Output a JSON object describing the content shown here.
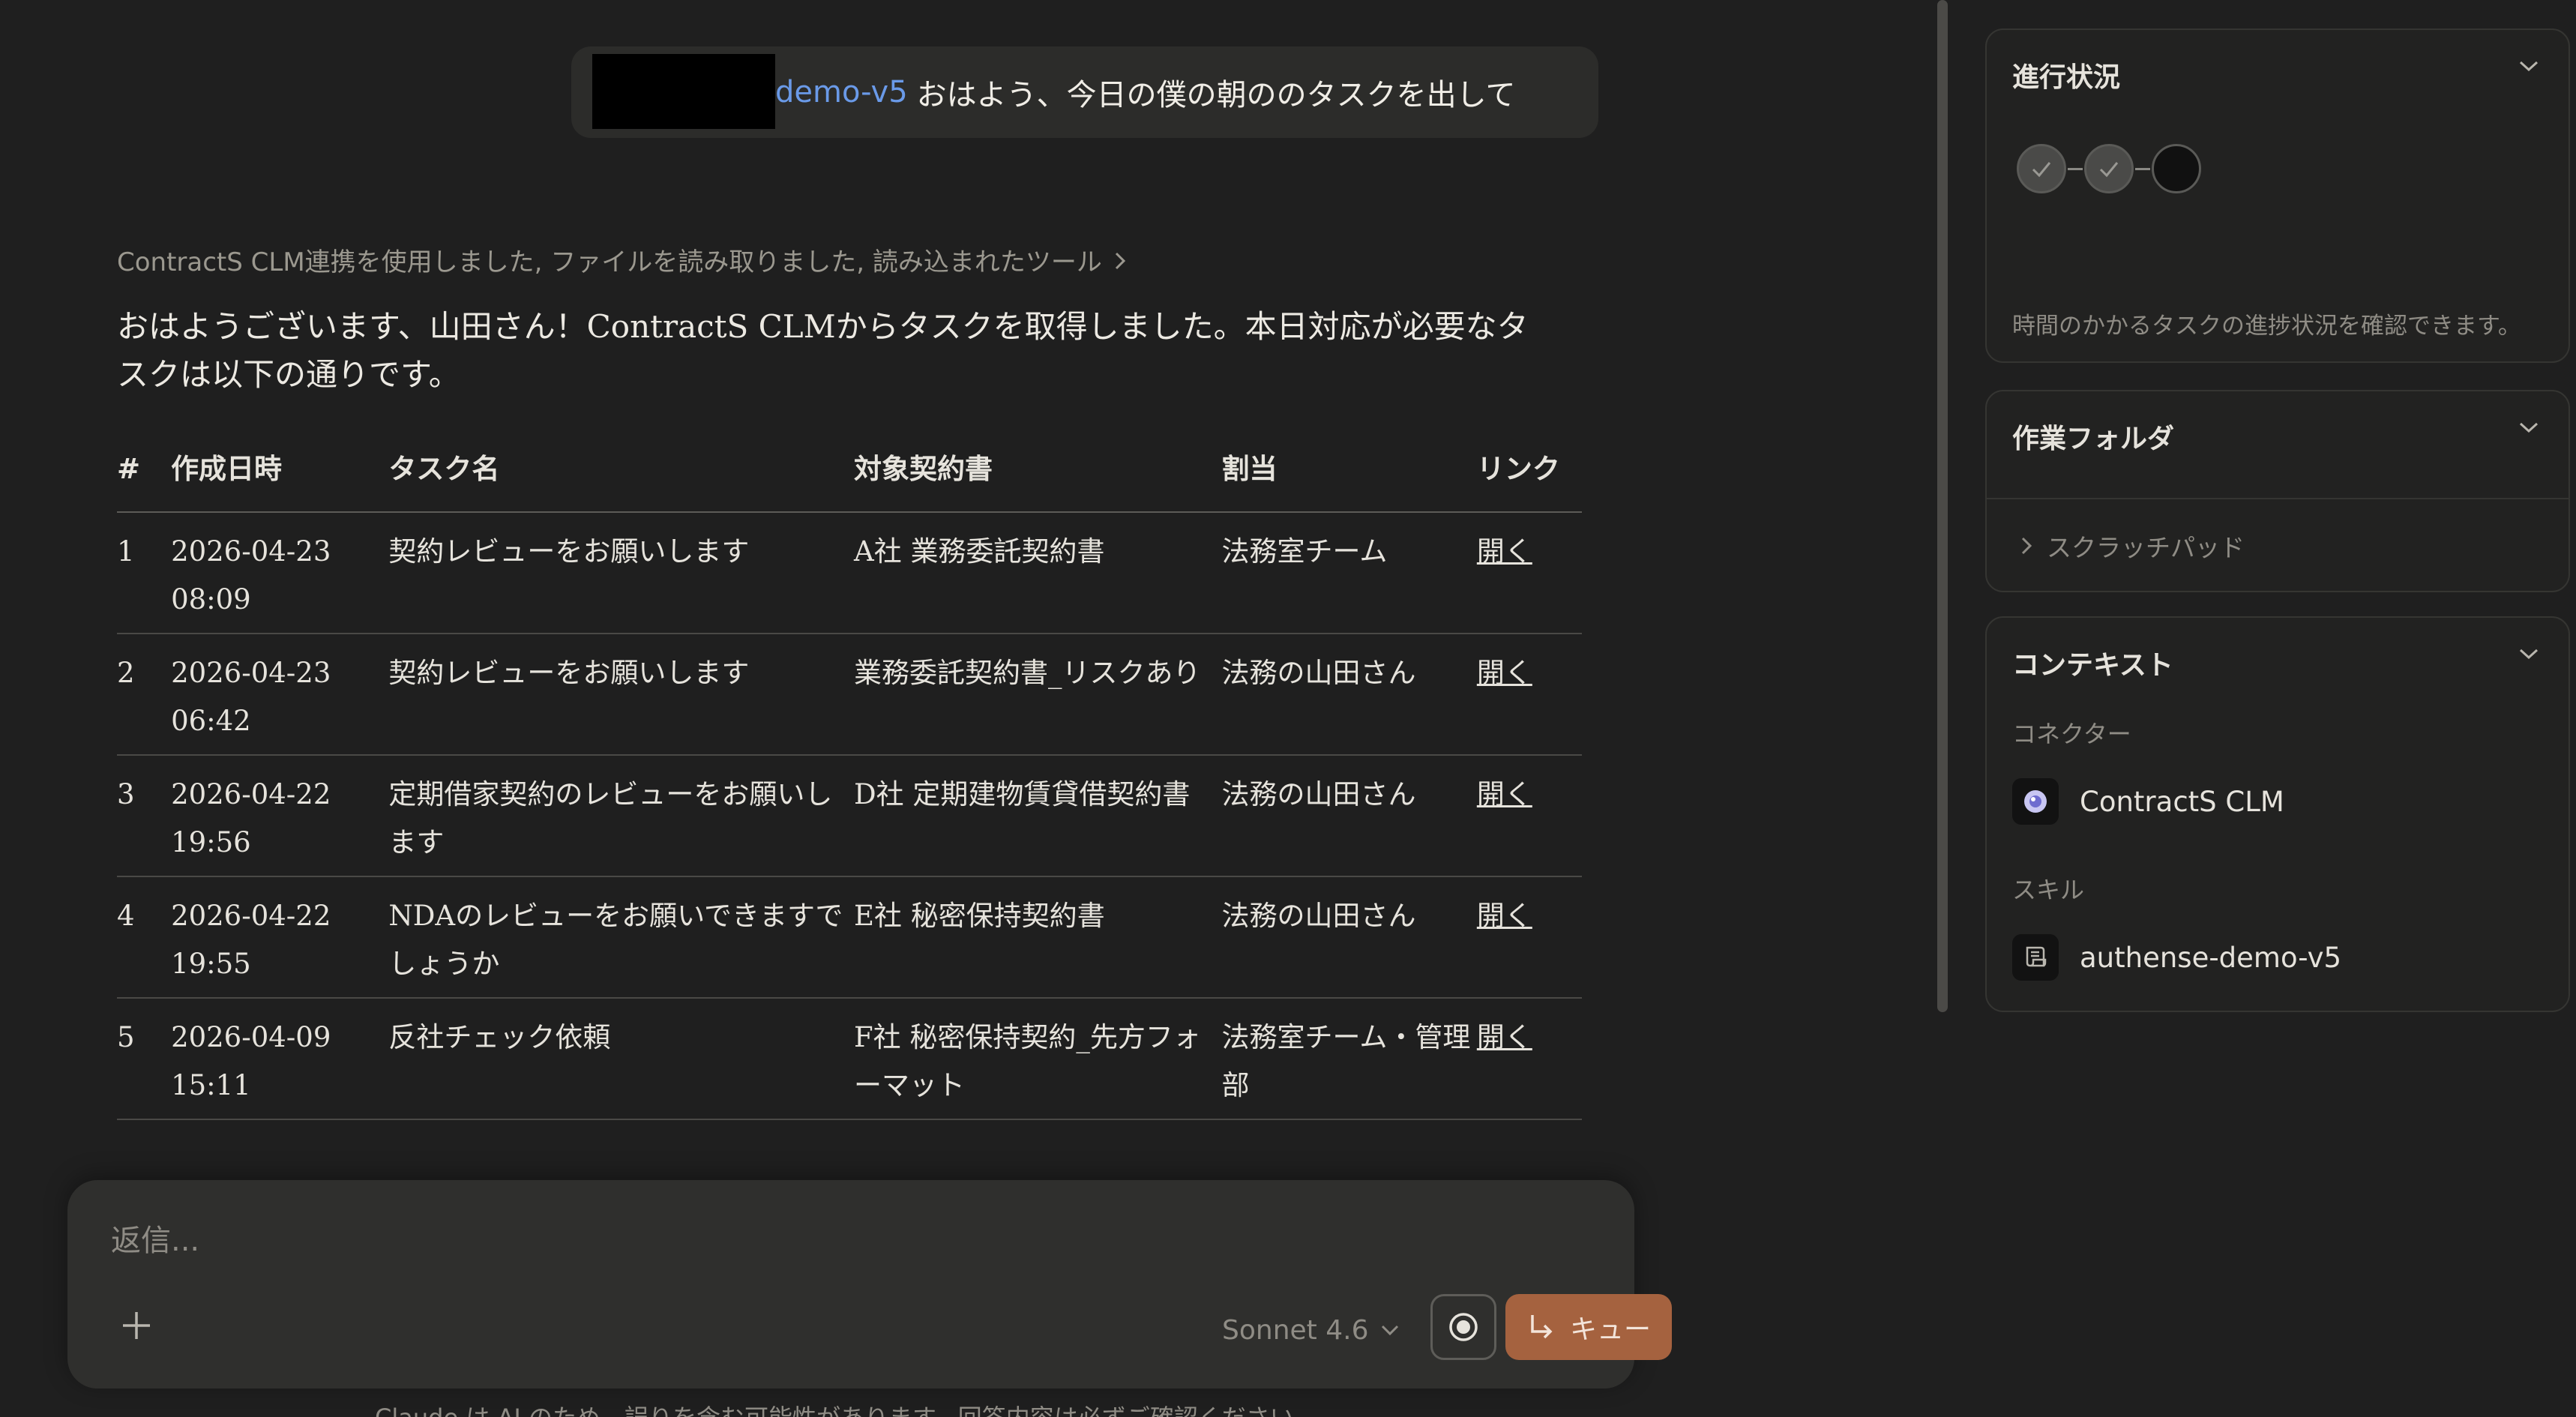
{
  "user_message": {
    "mention": "demo-v5",
    "text": "おはよう、今日の僕の朝ののタスクを出して"
  },
  "tools_used": {
    "text": "ContractS CLM連携を使用しました, ファイルを読み取りました, 読み込まれたツール",
    "chevron_icon": "chevron-right-icon"
  },
  "answer": {
    "text": "おはようございます、山田さん！ContractS CLMからタスクを取得しました。本日対応が必要なタスクは以下の通りです。"
  },
  "table": {
    "headers": {
      "num": "#",
      "date": "作成日時",
      "task": "タスク名",
      "doc": "対象契約書",
      "assign": "割当",
      "link": "リンク"
    },
    "rows": [
      {
        "num": "1",
        "date": "2026-04-23 08:09",
        "task": "契約レビューをお願いします",
        "doc": "A社 業務委託契約書",
        "assign": "法務室チーム",
        "link": "開く"
      },
      {
        "num": "2",
        "date": "2026-04-23 06:42",
        "task": "契約レビューをお願いします",
        "doc": "業務委託契約書_リスクあり",
        "assign": "法務の山田さん",
        "link": "開く"
      },
      {
        "num": "3",
        "date": "2026-04-22 19:56",
        "task": "定期借家契約のレビューをお願いします",
        "doc": "D社 定期建物賃貸借契約書",
        "assign": "法務の山田さん",
        "link": "開く"
      },
      {
        "num": "4",
        "date": "2026-04-22 19:55",
        "task": "NDAのレビューをお願いできますでしょうか",
        "doc": "E社 秘密保持契約書",
        "assign": "法務の山田さん",
        "link": "開く"
      },
      {
        "num": "5",
        "date": "2026-04-09 15:11",
        "task": "反社チェック依頼",
        "doc": "F社 秘密保持契約_先方フォーマット",
        "assign": "法務室チーム・管理部",
        "link": "開く"
      }
    ]
  },
  "composer": {
    "placeholder": "返信...",
    "model": "Sonnet 4.6",
    "queue_label": "キュー",
    "disclaimer": "Claude は AI のため、誤りを含む可能性があります。回答内容は必ずご確認ください。"
  },
  "progress_panel": {
    "title": "進行状況",
    "steps": [
      "done",
      "done",
      "todo"
    ],
    "description": "時間のかかるタスクの進捗状況を確認できます。"
  },
  "folder_panel": {
    "title": "作業フォルダ",
    "item": "スクラッチパッド"
  },
  "context_panel": {
    "title": "コンテキスト",
    "connector_label": "コネクター",
    "connector_name": "ContractS CLM",
    "skill_label": "スキル",
    "skill_name": "authense-demo-v5"
  },
  "colors": {
    "background": "#1f1f1f",
    "mention": "#6a9ae8",
    "queue_button": "#a5623f"
  }
}
